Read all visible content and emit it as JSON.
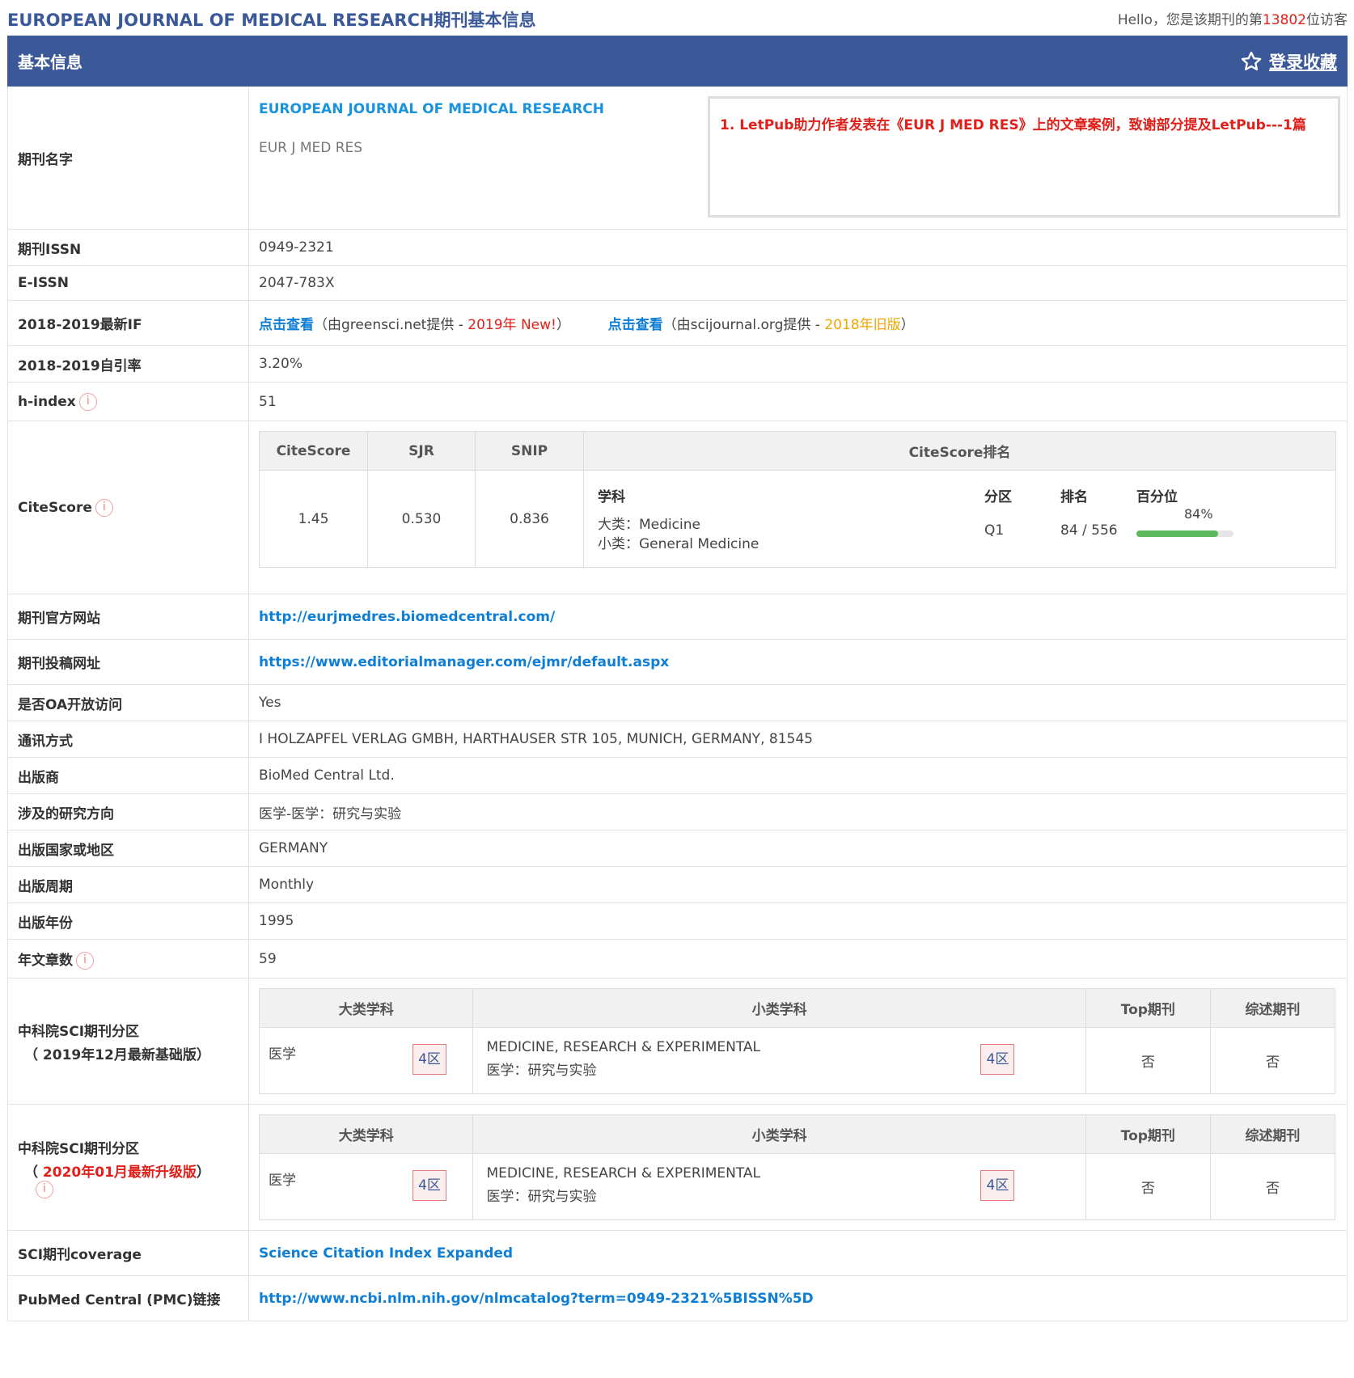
{
  "header": {
    "title": "EUROPEAN JOURNAL OF MEDICAL RESEARCH期刊基本信息",
    "visitor_prefix": "Hello，您是该期刊的第",
    "visitor_count": "13802",
    "visitor_suffix": "位访客"
  },
  "table_head": {
    "label": "基本信息",
    "favorite": "登录收藏"
  },
  "journal": {
    "name_label": "期刊名字",
    "name": "EUROPEAN JOURNAL OF MEDICAL RESEARCH",
    "abbr": "EUR J MED RES",
    "promo": "1. LetPub助力作者发表在《EUR J MED RES》上的文章案例，致谢部分提及LetPub---1篇"
  },
  "issn": {
    "label": "期刊ISSN",
    "value": "0949-2321"
  },
  "eissn": {
    "label": "E-ISSN",
    "value": "2047-783X"
  },
  "if": {
    "label": "2018-2019最新IF",
    "link1": "点击查看",
    "src1_prefix": "（由greensci.net提供 - ",
    "src1_tag": "2019年 New!",
    "src1_suffix": "）",
    "link2": "点击查看",
    "src2_prefix": "（由scijournal.org提供 - ",
    "src2_tag": "2018年旧版",
    "src2_suffix": "）"
  },
  "self_cite": {
    "label": "2018-2019自引率",
    "value": "3.20%"
  },
  "hindex": {
    "label": "h-index",
    "value": "51",
    "info_icon": "i"
  },
  "citescore": {
    "label": "CiteScore",
    "info_icon": "i",
    "headers": [
      "CiteScore",
      "SJR",
      "SNIP",
      "CiteScore排名"
    ],
    "values": [
      "1.45",
      "0.530",
      "0.836"
    ],
    "rank": {
      "subject_header": "学科",
      "zone_header": "分区",
      "rank_header": "排名",
      "percentile_header": "百分位",
      "major": "大类：Medicine",
      "minor": "小类：General Medicine",
      "zone": "Q1",
      "rank": "84 / 556",
      "percentile_text": "84%",
      "percentile": 84
    }
  },
  "website": {
    "label": "期刊官方网站",
    "url": "http://eurjmedres.biomedcentral.com/"
  },
  "submission": {
    "label": "期刊投稿网址",
    "url": "https://www.editorialmanager.com/ejmr/default.aspx"
  },
  "oa": {
    "label": "是否OA开放访问",
    "value": "Yes"
  },
  "contact": {
    "label": "通讯方式",
    "value": "I HOLZAPFEL VERLAG GMBH, HARTHAUSER STR 105, MUNICH, GERMANY, 81545"
  },
  "publisher": {
    "label": "出版商",
    "value": "BioMed Central Ltd."
  },
  "field": {
    "label": "涉及的研究方向",
    "value": "医学-医学：研究与实验"
  },
  "country": {
    "label": "出版国家或地区",
    "value": "GERMANY"
  },
  "frequency": {
    "label": "出版周期",
    "value": "Monthly"
  },
  "year": {
    "label": "出版年份",
    "value": "1995"
  },
  "articles": {
    "label": "年文章数",
    "value": "59",
    "info_icon": "i"
  },
  "cas2019": {
    "label_line1": "中科院SCI期刊分区",
    "label_line2": "（ 2019年12月最新基础版）",
    "headers": [
      "大类学科",
      "小类学科",
      "Top期刊",
      "综述期刊"
    ],
    "major": "医学",
    "major_zone": "4区",
    "minor_en": "MEDICINE, RESEARCH & EXPERIMENTAL",
    "minor_cn": "医学：研究与实验",
    "minor_zone": "4区",
    "top": "否",
    "review": "否"
  },
  "cas2020": {
    "label_line1": "中科院SCI期刊分区",
    "label_open": "（ ",
    "label_red": "2020年01月最新升级版",
    "label_close": "）",
    "info_icon": "i",
    "headers": [
      "大类学科",
      "小类学科",
      "Top期刊",
      "综述期刊"
    ],
    "major": "医学",
    "major_zone": "4区",
    "minor_en": "MEDICINE, RESEARCH & EXPERIMENTAL",
    "minor_cn": "医学：研究与实验",
    "minor_zone": "4区",
    "top": "否",
    "review": "否"
  },
  "coverage": {
    "label": "SCI期刊coverage",
    "value": "Science Citation Index Expanded"
  },
  "pmc": {
    "label": "PubMed Central (PMC)链接",
    "url": "http://www.ncbi.nlm.nih.gov/nlmcatalog?term=0949-2321%5BISSN%5D"
  },
  "colors": {
    "header_bg": "#3b5998",
    "link": "#0f7fd6",
    "accent_red": "#e0201b",
    "percentile_bar": "#5cb85c"
  },
  "icons": {
    "favorite": "star-outline-icon",
    "info": "info-circle-icon"
  }
}
